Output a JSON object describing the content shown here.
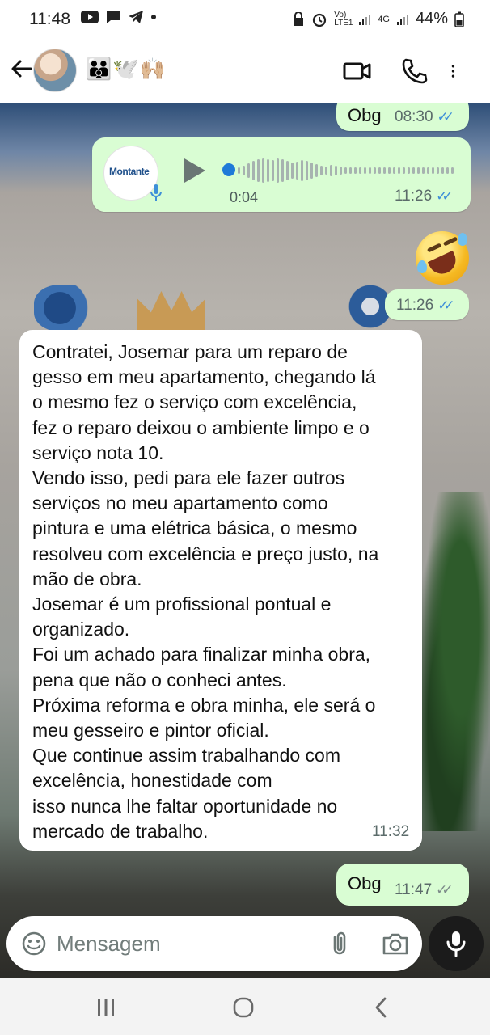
{
  "status_bar": {
    "time": "11:48",
    "network_label": "Vo) LTE1",
    "signal_label": "4G",
    "battery": "44%"
  },
  "header": {
    "contact_name": "👪🕊️🙌🏼"
  },
  "messages": [
    {
      "type": "text",
      "direction": "outgoing",
      "text": "Obg",
      "time": "08:30",
      "status": "read"
    },
    {
      "type": "voice",
      "direction": "outgoing",
      "thumb_label": "Montante",
      "duration": "0:04",
      "time": "11:26",
      "status": "read",
      "progress": 0
    },
    {
      "type": "emoji",
      "direction": "outgoing",
      "emoji_name": "rolling-on-the-floor-laughing"
    },
    {
      "type": "time-only",
      "direction": "outgoing",
      "time": "11:26",
      "status": "read"
    },
    {
      "type": "text",
      "direction": "incoming",
      "text": "Contratei, Josemar para um reparo de\ngesso em meu apartamento, chegando lá\no mesmo fez o serviço com excelência,\nfez o reparo deixou o ambiente limpo e o\nserviço nota 10.\nVendo isso, pedi para ele fazer outros\nserviços no meu apartamento como\npintura e uma elétrica básica, o mesmo\nresolveu com excelência e preço justo, na\nmão de obra.\nJosemar é um profissional pontual e\norganizado.\nFoi um achado para finalizar minha obra,\npena que não o conheci antes.\nPróxima reforma e obra minha, ele será o\nmeu gesseiro e pintor oficial.\nQue continue assim trabalhando com\nexcelência, honestidade com\nisso nunca lhe faltar oportunidade no\nmercado de trabalho.",
      "time": "11:32"
    },
    {
      "type": "text",
      "direction": "outgoing",
      "text": "Obg",
      "time": "11:47",
      "status": "delivered"
    }
  ],
  "input_bar": {
    "placeholder": "Mensagem",
    "value": ""
  },
  "colors": {
    "outgoing_bubble": "#d9fdd3",
    "incoming_bubble": "#ffffff",
    "read_ticks": "#3e8fd8",
    "mic_button": "#1b1b1b"
  }
}
